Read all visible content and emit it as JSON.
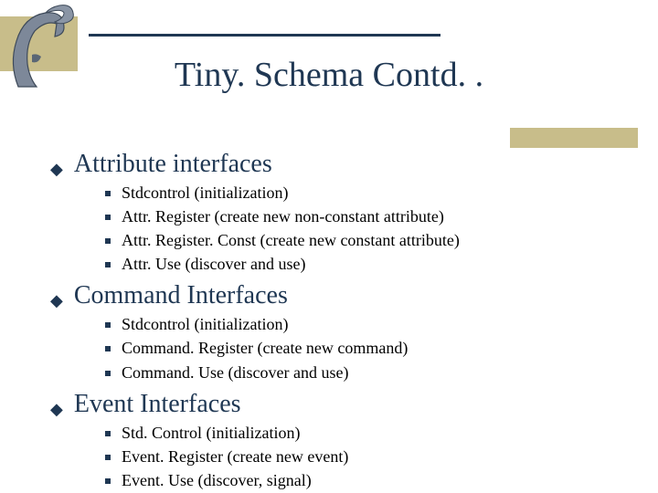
{
  "title": "Tiny. Schema Contd. .",
  "sections": [
    {
      "label": "Attribute interfaces",
      "items": [
        "Stdcontrol (initialization)",
        "Attr. Register (create new non-constant attribute)",
        "Attr. Register. Const (create new constant attribute)",
        "Attr. Use (discover and use)"
      ]
    },
    {
      "label": "Command Interfaces",
      "items": [
        "Stdcontrol (initialization)",
        "Command. Register (create new command)",
        "Command. Use (discover and use)"
      ]
    },
    {
      "label": "Event Interfaces",
      "items": [
        "Std. Control (initialization)",
        "Event. Register (create new event)",
        "Event. Use (discover, signal)"
      ]
    }
  ]
}
